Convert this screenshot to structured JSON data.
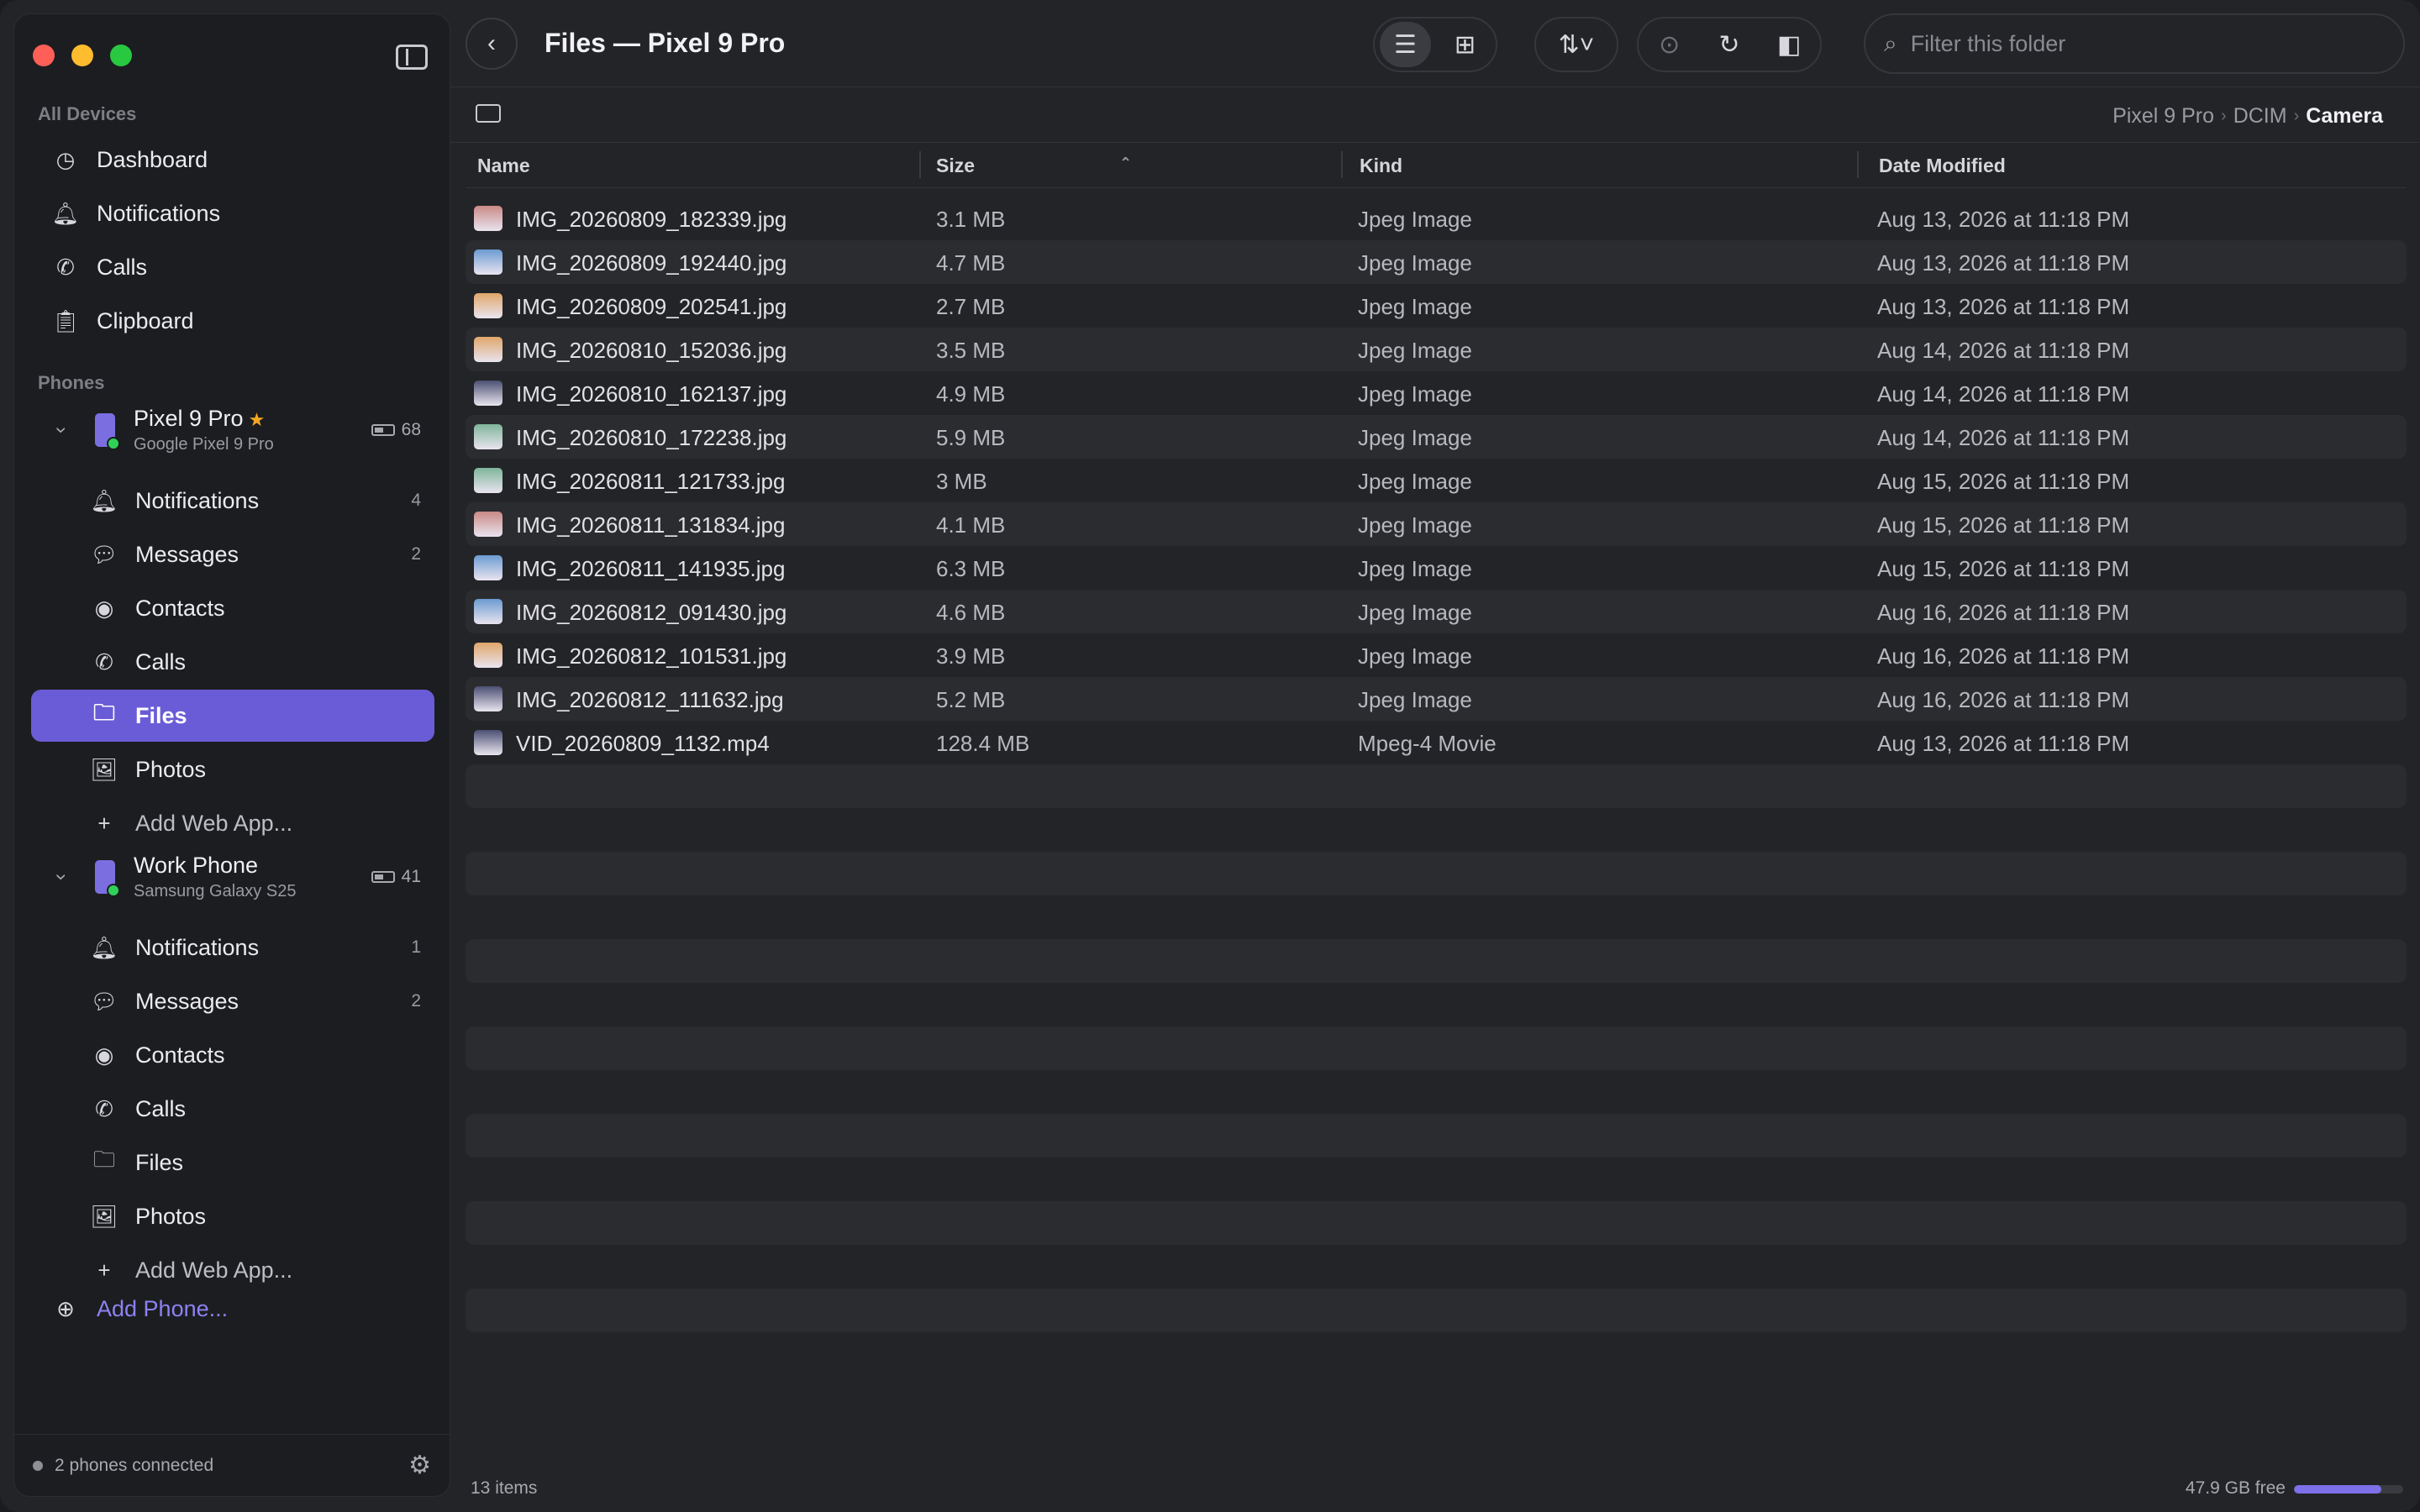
{
  "sidebar": {
    "sections": {
      "devices": "All Devices",
      "phones": "Phones"
    },
    "devices": [
      {
        "label": "Dashboard",
        "icon": "gauge-icon",
        "glyph": "◷"
      },
      {
        "label": "Notifications",
        "icon": "bell-icon",
        "glyph": "🔔︎"
      },
      {
        "label": "Calls",
        "icon": "phone-icon",
        "glyph": "✆"
      },
      {
        "label": "Clipboard",
        "icon": "clipboard-icon",
        "glyph": "📋︎"
      }
    ],
    "phone1": {
      "name": "Pixel 9 Pro",
      "model": "Google Pixel 9 Pro",
      "battery": "68",
      "items": [
        {
          "label": "Notifications",
          "badge": "4",
          "glyph": "🔔︎"
        },
        {
          "label": "Messages",
          "badge": "2",
          "glyph": "💬︎"
        },
        {
          "label": "Contacts",
          "badge": "",
          "glyph": "◉"
        },
        {
          "label": "Calls",
          "badge": "",
          "glyph": "✆"
        },
        {
          "label": "Files",
          "badge": "",
          "glyph": "🗀"
        },
        {
          "label": "Photos",
          "badge": "",
          "glyph": "🖼︎"
        },
        {
          "label": "Add Web App...",
          "badge": "",
          "glyph": "+"
        }
      ]
    },
    "phone2": {
      "name": "Work Phone",
      "model": "Samsung Galaxy S25",
      "battery": "41",
      "items": [
        {
          "label": "Notifications",
          "badge": "1",
          "glyph": "🔔︎"
        },
        {
          "label": "Messages",
          "badge": "2",
          "glyph": "💬︎"
        },
        {
          "label": "Contacts",
          "badge": "",
          "glyph": "◉"
        },
        {
          "label": "Calls",
          "badge": "",
          "glyph": "✆"
        },
        {
          "label": "Files",
          "badge": "",
          "glyph": "🗀"
        },
        {
          "label": "Photos",
          "badge": "",
          "glyph": "🖼︎"
        },
        {
          "label": "Add Web App...",
          "badge": "",
          "glyph": "+"
        }
      ]
    },
    "add_phone": "Add Phone...",
    "footer_status": "2 phones connected"
  },
  "toolbar": {
    "title": "Files — Pixel 9 Pro",
    "search_placeholder": "Filter this folder"
  },
  "breadcrumb": [
    "Pixel 9 Pro",
    "DCIM",
    "Camera"
  ],
  "columns": {
    "name": "Name",
    "size": "Size",
    "kind": "Kind",
    "date": "Date Modified"
  },
  "files": [
    {
      "name": "IMG_20260809_182339.jpg",
      "size": "3.1 MB",
      "kind": "Jpeg Image",
      "date": "Aug 13, 2026 at 11:18 PM",
      "thumb": "#c98a86"
    },
    {
      "name": "IMG_20260809_192440.jpg",
      "size": "4.7 MB",
      "kind": "Jpeg Image",
      "date": "Aug 13, 2026 at 11:18 PM",
      "thumb": "#6b9bd1"
    },
    {
      "name": "IMG_20260809_202541.jpg",
      "size": "2.7 MB",
      "kind": "Jpeg Image",
      "date": "Aug 13, 2026 at 11:18 PM",
      "thumb": "#e0a66a"
    },
    {
      "name": "IMG_20260810_152036.jpg",
      "size": "3.5 MB",
      "kind": "Jpeg Image",
      "date": "Aug 14, 2026 at 11:18 PM",
      "thumb": "#e0a66a"
    },
    {
      "name": "IMG_20260810_162137.jpg",
      "size": "4.9 MB",
      "kind": "Jpeg Image",
      "date": "Aug 14, 2026 at 11:18 PM",
      "thumb": "#4a4f72"
    },
    {
      "name": "IMG_20260810_172238.jpg",
      "size": "5.9 MB",
      "kind": "Jpeg Image",
      "date": "Aug 14, 2026 at 11:18 PM",
      "thumb": "#7fb59a"
    },
    {
      "name": "IMG_20260811_121733.jpg",
      "size": "3 MB",
      "kind": "Jpeg Image",
      "date": "Aug 15, 2026 at 11:18 PM",
      "thumb": "#7fb59a"
    },
    {
      "name": "IMG_20260811_131834.jpg",
      "size": "4.1 MB",
      "kind": "Jpeg Image",
      "date": "Aug 15, 2026 at 11:18 PM",
      "thumb": "#c98a86"
    },
    {
      "name": "IMG_20260811_141935.jpg",
      "size": "6.3 MB",
      "kind": "Jpeg Image",
      "date": "Aug 15, 2026 at 11:18 PM",
      "thumb": "#6b9bd1"
    },
    {
      "name": "IMG_20260812_091430.jpg",
      "size": "4.6 MB",
      "kind": "Jpeg Image",
      "date": "Aug 16, 2026 at 11:18 PM",
      "thumb": "#6b9bd1"
    },
    {
      "name": "IMG_20260812_101531.jpg",
      "size": "3.9 MB",
      "kind": "Jpeg Image",
      "date": "Aug 16, 2026 at 11:18 PM",
      "thumb": "#e0a66a"
    },
    {
      "name": "IMG_20260812_111632.jpg",
      "size": "5.2 MB",
      "kind": "Jpeg Image",
      "date": "Aug 16, 2026 at 11:18 PM",
      "thumb": "#4a4f72"
    },
    {
      "name": "VID_20260809_1132.mp4",
      "size": "128.4 MB",
      "kind": "Mpeg-4 Movie",
      "date": "Aug 13, 2026 at 11:18 PM",
      "thumb": "#4a4f72"
    }
  ],
  "status": {
    "count": "13 items",
    "free": "47.9 GB free",
    "storage_used_fraction": 0.8
  },
  "colors": {
    "accent": "#6a5cd6",
    "link": "#8d82f2",
    "online": "#30d158",
    "star": "#f5a623"
  }
}
